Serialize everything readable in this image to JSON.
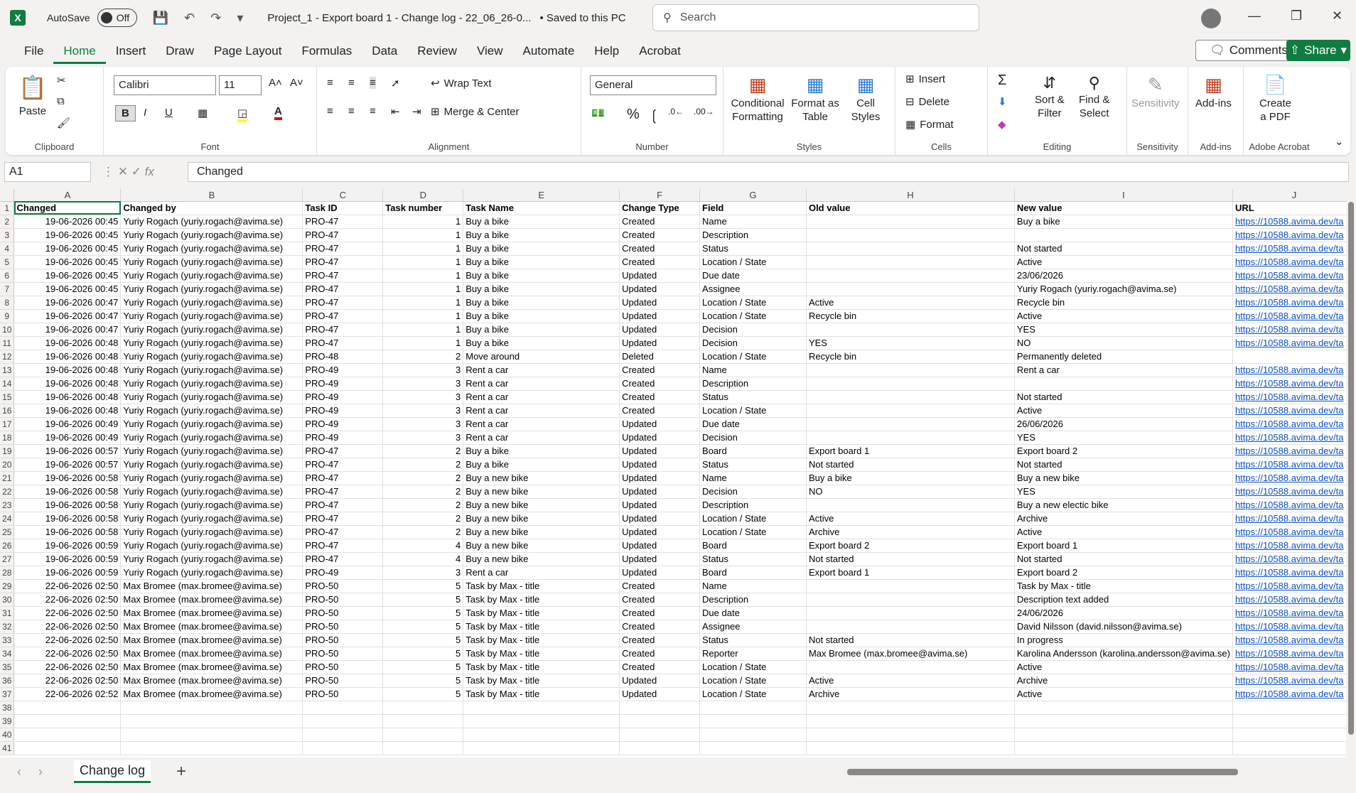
{
  "app": {
    "autosave_label": "AutoSave",
    "autosave_state": "Off",
    "title": "Project_1 - Export board 1 - Change log - 22_06_26-0...",
    "save_status": "• Saved to this PC",
    "search_placeholder": "Search"
  },
  "menus": [
    "File",
    "Home",
    "Insert",
    "Draw",
    "Page Layout",
    "Formulas",
    "Data",
    "Review",
    "View",
    "Automate",
    "Help",
    "Acrobat"
  ],
  "active_menu": "Home",
  "buttons": {
    "comments": "Comments",
    "share": "Share"
  },
  "ribbon": {
    "clipboard": {
      "label": "Clipboard",
      "paste": "Paste"
    },
    "font": {
      "label": "Font",
      "family": "Calibri",
      "size": "11",
      "bold": "B",
      "italic": "I",
      "underline": "U"
    },
    "alignment": {
      "label": "Alignment",
      "wrap": "Wrap Text",
      "merge": "Merge & Center"
    },
    "number": {
      "label": "Number",
      "format": "General"
    },
    "styles": {
      "label": "Styles",
      "conditional_1": "Conditional",
      "conditional_2": "Formatting",
      "format_table_1": "Format as",
      "format_table_2": "Table",
      "cell_styles_1": "Cell",
      "cell_styles_2": "Styles"
    },
    "cells": {
      "label": "Cells",
      "insert": "Insert",
      "delete": "Delete",
      "format": "Format"
    },
    "editing": {
      "label": "Editing",
      "sort_1": "Sort &",
      "sort_2": "Filter",
      "find_1": "Find &",
      "find_2": "Select"
    },
    "sensitivity": {
      "label": "Sensitivity",
      "button": "Sensitivity"
    },
    "addins": {
      "label": "Add-ins",
      "button": "Add-ins"
    },
    "acrobat": {
      "label": "Adobe Acrobat",
      "button_1": "Create",
      "button_2": "a PDF"
    }
  },
  "formula_bar": {
    "name_box": "A1",
    "formula": "Changed",
    "fx": "fx"
  },
  "columns": [
    "A",
    "B",
    "C",
    "D",
    "E",
    "F",
    "G",
    "H",
    "I",
    "J"
  ],
  "headers": [
    "Changed",
    "Changed by",
    "Task ID",
    "Task number",
    "Task Name",
    "Change Type",
    "Field",
    "Old value",
    "New value",
    "URL"
  ],
  "rows": [
    [
      "19-06-2026 00:45",
      "Yuriy Rogach (yuriy.rogach@avima.se)",
      "PRO-47",
      "1",
      "Buy a bike",
      "Created",
      "Name",
      "",
      "Buy a bike",
      "https://10588.avima.dev/ta"
    ],
    [
      "19-06-2026 00:45",
      "Yuriy Rogach (yuriy.rogach@avima.se)",
      "PRO-47",
      "1",
      "Buy a bike",
      "Created",
      "Description",
      "",
      "",
      "https://10588.avima.dev/ta"
    ],
    [
      "19-06-2026 00:45",
      "Yuriy Rogach (yuriy.rogach@avima.se)",
      "PRO-47",
      "1",
      "Buy a bike",
      "Created",
      "Status",
      "",
      "Not started",
      "https://10588.avima.dev/ta"
    ],
    [
      "19-06-2026 00:45",
      "Yuriy Rogach (yuriy.rogach@avima.se)",
      "PRO-47",
      "1",
      "Buy a bike",
      "Created",
      "Location / State",
      "",
      "Active",
      "https://10588.avima.dev/ta"
    ],
    [
      "19-06-2026 00:45",
      "Yuriy Rogach (yuriy.rogach@avima.se)",
      "PRO-47",
      "1",
      "Buy a bike",
      "Updated",
      "Due date",
      "",
      "23/06/2026",
      "https://10588.avima.dev/ta"
    ],
    [
      "19-06-2026 00:45",
      "Yuriy Rogach (yuriy.rogach@avima.se)",
      "PRO-47",
      "1",
      "Buy a bike",
      "Updated",
      "Assignee",
      "",
      "Yuriy Rogach (yuriy.rogach@avima.se)",
      "https://10588.avima.dev/ta"
    ],
    [
      "19-06-2026 00:47",
      "Yuriy Rogach (yuriy.rogach@avima.se)",
      "PRO-47",
      "1",
      "Buy a bike",
      "Updated",
      "Location / State",
      "Active",
      "Recycle bin",
      "https://10588.avima.dev/ta"
    ],
    [
      "19-06-2026 00:47",
      "Yuriy Rogach (yuriy.rogach@avima.se)",
      "PRO-47",
      "1",
      "Buy a bike",
      "Updated",
      "Location / State",
      "Recycle bin",
      "Active",
      "https://10588.avima.dev/ta"
    ],
    [
      "19-06-2026 00:47",
      "Yuriy Rogach (yuriy.rogach@avima.se)",
      "PRO-47",
      "1",
      "Buy a bike",
      "Updated",
      "Decision",
      "",
      "YES",
      "https://10588.avima.dev/ta"
    ],
    [
      "19-06-2026 00:48",
      "Yuriy Rogach (yuriy.rogach@avima.se)",
      "PRO-47",
      "1",
      "Buy a bike",
      "Updated",
      "Decision",
      "YES",
      "NO",
      "https://10588.avima.dev/ta"
    ],
    [
      "19-06-2026 00:48",
      "Yuriy Rogach (yuriy.rogach@avima.se)",
      "PRO-48",
      "2",
      "Move around",
      "Deleted",
      "Location / State",
      "Recycle bin",
      "Permanently deleted",
      ""
    ],
    [
      "19-06-2026 00:48",
      "Yuriy Rogach (yuriy.rogach@avima.se)",
      "PRO-49",
      "3",
      "Rent a car",
      "Created",
      "Name",
      "",
      "Rent a car",
      "https://10588.avima.dev/ta"
    ],
    [
      "19-06-2026 00:48",
      "Yuriy Rogach (yuriy.rogach@avima.se)",
      "PRO-49",
      "3",
      "Rent a car",
      "Created",
      "Description",
      "",
      "",
      "https://10588.avima.dev/ta"
    ],
    [
      "19-06-2026 00:48",
      "Yuriy Rogach (yuriy.rogach@avima.se)",
      "PRO-49",
      "3",
      "Rent a car",
      "Created",
      "Status",
      "",
      "Not started",
      "https://10588.avima.dev/ta"
    ],
    [
      "19-06-2026 00:48",
      "Yuriy Rogach (yuriy.rogach@avima.se)",
      "PRO-49",
      "3",
      "Rent a car",
      "Created",
      "Location / State",
      "",
      "Active",
      "https://10588.avima.dev/ta"
    ],
    [
      "19-06-2026 00:49",
      "Yuriy Rogach (yuriy.rogach@avima.se)",
      "PRO-49",
      "3",
      "Rent a car",
      "Updated",
      "Due date",
      "",
      "26/06/2026",
      "https://10588.avima.dev/ta"
    ],
    [
      "19-06-2026 00:49",
      "Yuriy Rogach (yuriy.rogach@avima.se)",
      "PRO-49",
      "3",
      "Rent a car",
      "Updated",
      "Decision",
      "",
      "YES",
      "https://10588.avima.dev/ta"
    ],
    [
      "19-06-2026 00:57",
      "Yuriy Rogach (yuriy.rogach@avima.se)",
      "PRO-47",
      "2",
      "Buy a bike",
      "Updated",
      "Board",
      "Export board 1",
      "Export board 2",
      "https://10588.avima.dev/ta"
    ],
    [
      "19-06-2026 00:57",
      "Yuriy Rogach (yuriy.rogach@avima.se)",
      "PRO-47",
      "2",
      "Buy a bike",
      "Updated",
      "Status",
      "Not started",
      "Not started",
      "https://10588.avima.dev/ta"
    ],
    [
      "19-06-2026 00:58",
      "Yuriy Rogach (yuriy.rogach@avima.se)",
      "PRO-47",
      "2",
      "Buy a new bike",
      "Updated",
      "Name",
      "Buy a bike",
      "Buy a new bike",
      "https://10588.avima.dev/ta"
    ],
    [
      "19-06-2026 00:58",
      "Yuriy Rogach (yuriy.rogach@avima.se)",
      "PRO-47",
      "2",
      "Buy a new bike",
      "Updated",
      "Decision",
      "NO",
      "YES",
      "https://10588.avima.dev/ta"
    ],
    [
      "19-06-2026 00:58",
      "Yuriy Rogach (yuriy.rogach@avima.se)",
      "PRO-47",
      "2",
      "Buy a new bike",
      "Updated",
      "Description",
      "",
      "Buy a new electic bike",
      "https://10588.avima.dev/ta"
    ],
    [
      "19-06-2026 00:58",
      "Yuriy Rogach (yuriy.rogach@avima.se)",
      "PRO-47",
      "2",
      "Buy a new bike",
      "Updated",
      "Location / State",
      "Active",
      "Archive",
      "https://10588.avima.dev/ta"
    ],
    [
      "19-06-2026 00:58",
      "Yuriy Rogach (yuriy.rogach@avima.se)",
      "PRO-47",
      "2",
      "Buy a new bike",
      "Updated",
      "Location / State",
      "Archive",
      "Active",
      "https://10588.avima.dev/ta"
    ],
    [
      "19-06-2026 00:59",
      "Yuriy Rogach (yuriy.rogach@avima.se)",
      "PRO-47",
      "4",
      "Buy a new bike",
      "Updated",
      "Board",
      "Export board 2",
      "Export board 1",
      "https://10588.avima.dev/ta"
    ],
    [
      "19-06-2026 00:59",
      "Yuriy Rogach (yuriy.rogach@avima.se)",
      "PRO-47",
      "4",
      "Buy a new bike",
      "Updated",
      "Status",
      "Not started",
      "Not started",
      "https://10588.avima.dev/ta"
    ],
    [
      "19-06-2026 00:59",
      "Yuriy Rogach (yuriy.rogach@avima.se)",
      "PRO-49",
      "3",
      "Rent a car",
      "Updated",
      "Board",
      "Export board 1",
      "Export board 2",
      "https://10588.avima.dev/ta"
    ],
    [
      "22-06-2026 02:50",
      "Max Bromee (max.bromee@avima.se)",
      "PRO-50",
      "5",
      "Task by Max - title",
      "Created",
      "Name",
      "",
      "Task by Max - title",
      "https://10588.avima.dev/ta"
    ],
    [
      "22-06-2026 02:50",
      "Max Bromee (max.bromee@avima.se)",
      "PRO-50",
      "5",
      "Task by Max - title",
      "Created",
      "Description",
      "",
      "Description text added",
      "https://10588.avima.dev/ta"
    ],
    [
      "22-06-2026 02:50",
      "Max Bromee (max.bromee@avima.se)",
      "PRO-50",
      "5",
      "Task by Max - title",
      "Created",
      "Due date",
      "",
      "24/06/2026",
      "https://10588.avima.dev/ta"
    ],
    [
      "22-06-2026 02:50",
      "Max Bromee (max.bromee@avima.se)",
      "PRO-50",
      "5",
      "Task by Max - title",
      "Created",
      "Assignee",
      "",
      "David Nilsson (david.nilsson@avima.se)",
      "https://10588.avima.dev/ta"
    ],
    [
      "22-06-2026 02:50",
      "Max Bromee (max.bromee@avima.se)",
      "PRO-50",
      "5",
      "Task by Max - title",
      "Created",
      "Status",
      "Not started",
      "In progress",
      "https://10588.avima.dev/ta"
    ],
    [
      "22-06-2026 02:50",
      "Max Bromee (max.bromee@avima.se)",
      "PRO-50",
      "5",
      "Task by Max - title",
      "Created",
      "Reporter",
      "Max Bromee (max.bromee@avima.se)",
      "Karolina Andersson (karolina.andersson@avima.se)",
      "https://10588.avima.dev/ta"
    ],
    [
      "22-06-2026 02:50",
      "Max Bromee (max.bromee@avima.se)",
      "PRO-50",
      "5",
      "Task by Max - title",
      "Created",
      "Location / State",
      "",
      "Active",
      "https://10588.avima.dev/ta"
    ],
    [
      "22-06-2026 02:50",
      "Max Bromee (max.bromee@avima.se)",
      "PRO-50",
      "5",
      "Task by Max - title",
      "Updated",
      "Location / State",
      "Active",
      "Archive",
      "https://10588.avima.dev/ta"
    ],
    [
      "22-06-2026 02:52",
      "Max Bromee (max.bromee@avima.se)",
      "PRO-50",
      "5",
      "Task by Max - title",
      "Updated",
      "Location / State",
      "Archive",
      "Active",
      "https://10588.avima.dev/ta"
    ]
  ],
  "empty_row_numbers": [
    "38",
    "39",
    "40",
    "41"
  ],
  "sheet_tab": "Change log",
  "colors": {
    "accent": "#107c41",
    "link": "#0b51c5"
  }
}
